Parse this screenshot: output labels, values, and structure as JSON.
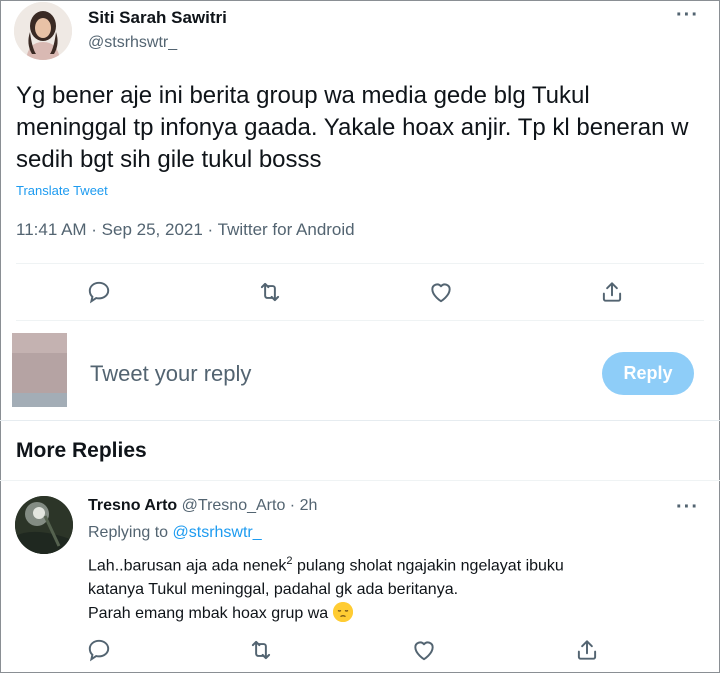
{
  "tweet": {
    "author_name": "Siti Sarah Sawitri",
    "author_handle": "@stsrhswtr_",
    "text": "Yg bener aje ini berita group wa media gede blg Tukul meninggal tp infonya gaada. Yakale hoax anjir. Tp kl beneran w sedih bgt sih gile tukul bosss",
    "translate_label": "Translate Tweet",
    "meta": "11:41 AM · Sep 25, 2021 · Twitter for Android",
    "more_label": "···"
  },
  "icons": {
    "reply": "reply-icon",
    "retweet": "retweet-icon",
    "like": "heart-icon",
    "share": "share-icon",
    "more": "more-icon"
  },
  "compose": {
    "placeholder": "Tweet your reply",
    "button_label": "Reply"
  },
  "more_replies": {
    "title": "More Replies",
    "reply": {
      "author_name": "Tresno Arto",
      "author_handle": "@Tresno_Arto",
      "separator": "·",
      "time": "2h",
      "replying_prefix": "Replying to ",
      "replying_handle": "@stsrhswtr_",
      "line1_a": "Lah..barusan aja ada nenek",
      "line1_sup": "2",
      "line1_b": " pulang sholat ngajakin ngelayat ibuku",
      "line2": "katanya Tukul meninggal, padahal gk ada beritanya.",
      "line3": "Parah emang mbak hoax grup wa ",
      "emoji": "pensive-face-emoji"
    }
  },
  "colors": {
    "accent": "#1d9bf0",
    "reply_button_disabled": "#8ecdf8",
    "secondary_text": "#536471"
  }
}
